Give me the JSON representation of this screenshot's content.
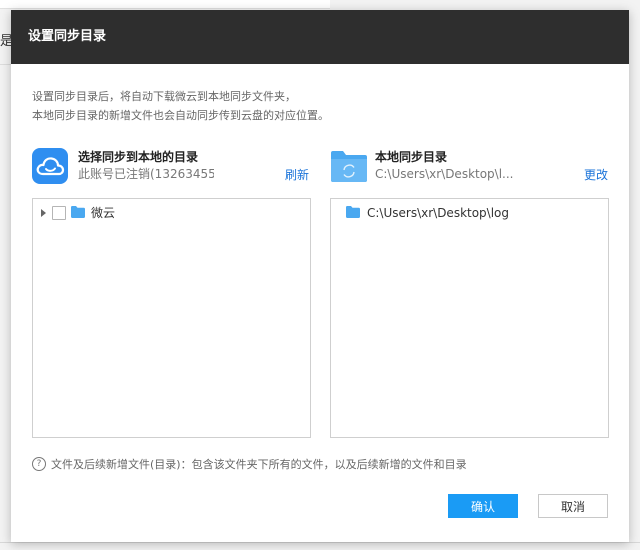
{
  "background": {
    "left_fragment": "是"
  },
  "dialog": {
    "title": "设置同步目录",
    "description_line1": "设置同步目录后，将自动下载微云到本地同步文件夹，",
    "description_line2": "本地同步目录的新增文件也会自动同步传到云盘的对应位置。",
    "left_section": {
      "title": "选择同步到本地的目录",
      "subtitle": "此账号已注销(13263455",
      "refresh_label": "刷新",
      "icon": "weiyun-cloud-icon",
      "tree": [
        {
          "label": "微云",
          "checked": false,
          "expanded": false
        }
      ]
    },
    "right_section": {
      "title": "本地同步目录",
      "subtitle": "C:\\Users\\xr\\Desktop\\l...",
      "change_label": "更改",
      "icon": "sync-folder-icon",
      "tree": [
        {
          "label": "C:\\Users\\xr\\Desktop\\log"
        }
      ]
    },
    "note": "文件及后续新增文件(目录)：包含该文件夹下所有的文件，以及后续新增的文件和目录",
    "confirm_label": "确认",
    "cancel_label": "取消"
  },
  "colors": {
    "header_bg": "#2e2e2e",
    "accent": "#1a9bf5",
    "link": "#1a73d9",
    "folder": "#4aa8f0"
  }
}
